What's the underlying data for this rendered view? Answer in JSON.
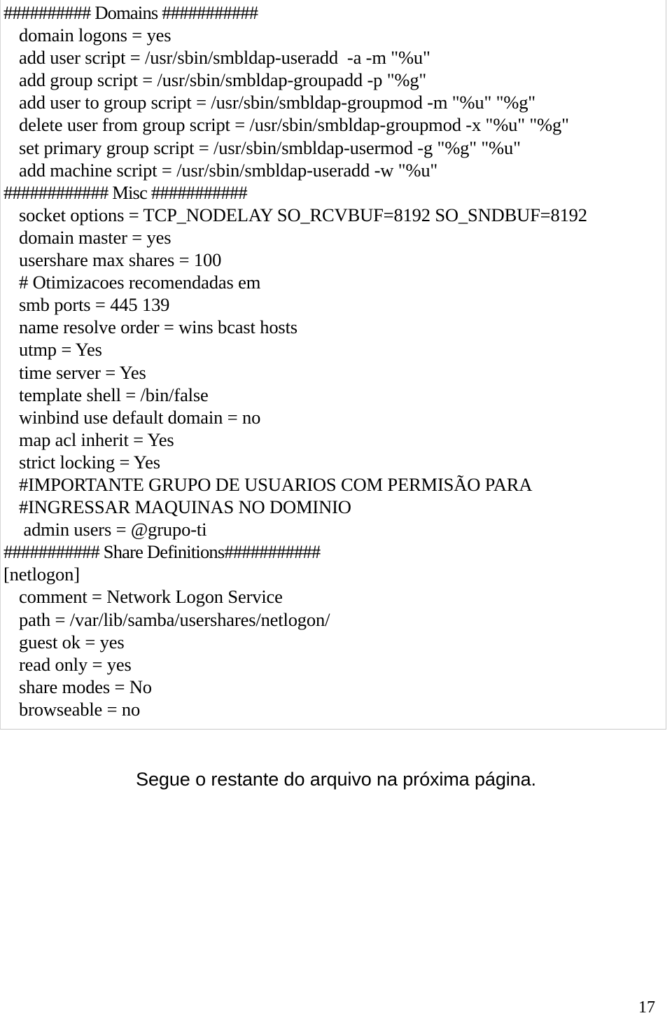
{
  "document": {
    "page_number": "17",
    "footer_note": "Segue o restante do arquivo na próxima página."
  },
  "config": {
    "lines": [
      {
        "text": "########## Domains ###########",
        "indent": 0,
        "kind": "section-header"
      },
      {
        "text": "domain logons = yes",
        "indent": 1,
        "kind": "directive"
      },
      {
        "text": "add user script = /usr/sbin/smbldap-useradd  -a -m \"%u\"",
        "indent": 1,
        "kind": "directive"
      },
      {
        "text": "add group script = /usr/sbin/smbldap-groupadd -p \"%g\"",
        "indent": 1,
        "kind": "directive"
      },
      {
        "text": "add user to group script = /usr/sbin/smbldap-groupmod -m \"%u\" \"%g\"",
        "indent": 1,
        "kind": "directive"
      },
      {
        "text": "delete user from group script = /usr/sbin/smbldap-groupmod -x \"%u\" \"%g\"",
        "indent": 1,
        "kind": "directive"
      },
      {
        "text": "set primary group script = /usr/sbin/smbldap-usermod -g \"%g\" \"%u\"",
        "indent": 1,
        "kind": "directive"
      },
      {
        "text": "add machine script = /usr/sbin/smbldap-useradd -w \"%u\"",
        "indent": 1,
        "kind": "directive"
      },
      {
        "text": "############ Misc ###########",
        "indent": 0,
        "kind": "section-header"
      },
      {
        "text": "socket options = TCP_NODELAY SO_RCVBUF=8192 SO_SNDBUF=8192",
        "indent": 1,
        "kind": "directive"
      },
      {
        "text": "domain master = yes",
        "indent": 1,
        "kind": "directive"
      },
      {
        "text": "usershare max shares = 100",
        "indent": 1,
        "kind": "directive"
      },
      {
        "text": "# Otimizacoes recomendadas em",
        "indent": 1,
        "kind": "comment"
      },
      {
        "text": "smb ports = 445 139",
        "indent": 1,
        "kind": "directive"
      },
      {
        "text": "name resolve order = wins bcast hosts",
        "indent": 1,
        "kind": "directive"
      },
      {
        "text": "utmp = Yes",
        "indent": 1,
        "kind": "directive"
      },
      {
        "text": "time server = Yes",
        "indent": 1,
        "kind": "directive"
      },
      {
        "text": "template shell = /bin/false",
        "indent": 1,
        "kind": "directive"
      },
      {
        "text": "winbind use default domain = no",
        "indent": 1,
        "kind": "directive"
      },
      {
        "text": "map acl inherit = Yes",
        "indent": 1,
        "kind": "directive"
      },
      {
        "text": "strict locking = Yes",
        "indent": 1,
        "kind": "directive"
      },
      {
        "text": "#IMPORTANTE GRUPO DE USUARIOS COM PERMISÃO PARA",
        "indent": 1,
        "kind": "comment"
      },
      {
        "text": "#INGRESSAR MAQUINAS NO DOMINIO",
        "indent": 1,
        "kind": "comment"
      },
      {
        "text": " admin users = @grupo-ti",
        "indent": 1,
        "kind": "directive"
      },
      {
        "text": "########### Share Definitions###########",
        "indent": 0,
        "kind": "section-header"
      },
      {
        "text": "[netlogon]",
        "indent": 0,
        "kind": "share-section"
      },
      {
        "text": "comment = Network Logon Service",
        "indent": 1,
        "kind": "directive"
      },
      {
        "text": "path = /var/lib/samba/usershares/netlogon/",
        "indent": 1,
        "kind": "directive"
      },
      {
        "text": "guest ok = yes",
        "indent": 1,
        "kind": "directive"
      },
      {
        "text": "read only = yes",
        "indent": 1,
        "kind": "directive"
      },
      {
        "text": "share modes = No",
        "indent": 1,
        "kind": "directive"
      },
      {
        "text": "browseable = no",
        "indent": 1,
        "kind": "directive"
      }
    ]
  }
}
